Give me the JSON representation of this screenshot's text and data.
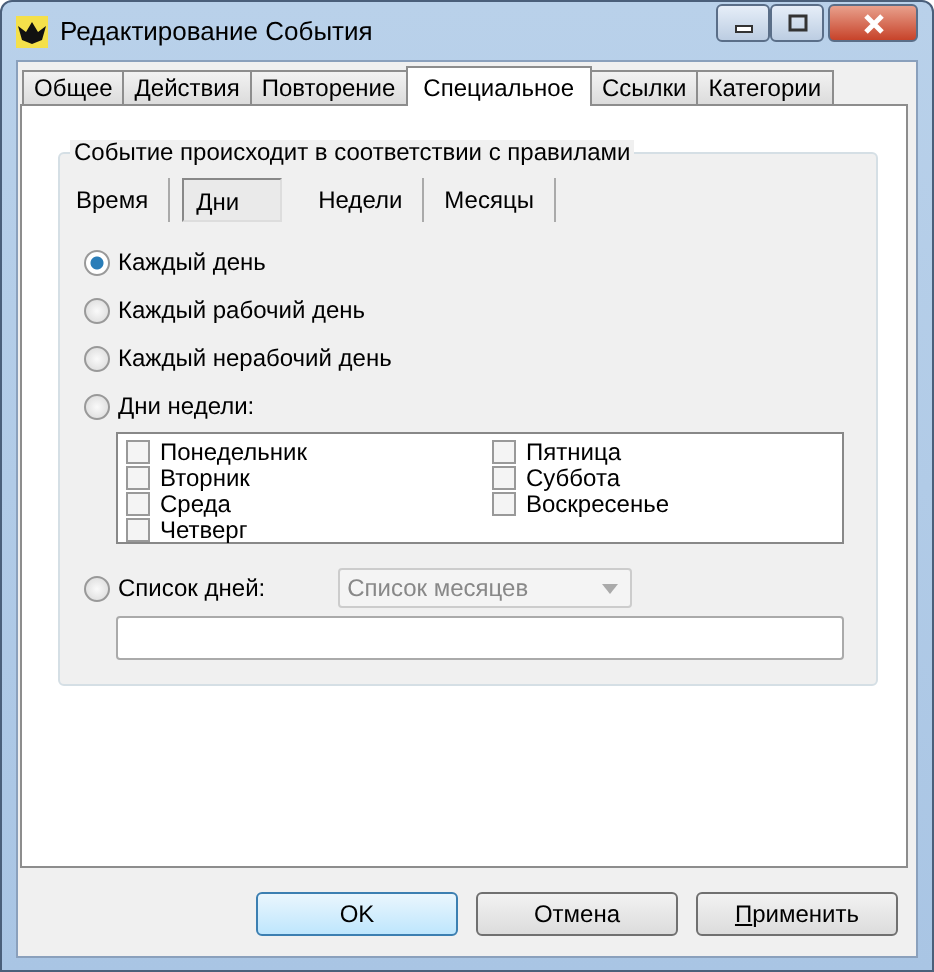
{
  "window": {
    "title": "Редактирование События"
  },
  "tabs": [
    {
      "label": "Общее",
      "selected": false
    },
    {
      "label": "Действия",
      "selected": false
    },
    {
      "label": "Повторение",
      "selected": false
    },
    {
      "label": "Специальное",
      "selected": true
    },
    {
      "label": "Ссылки",
      "selected": false
    },
    {
      "label": "Категории",
      "selected": false
    }
  ],
  "group": {
    "title": "Событие происходит в соответствии с правилами",
    "tabs": [
      {
        "label": "Время",
        "selected": false
      },
      {
        "label": "Дни",
        "selected": true
      },
      {
        "label": "Недели",
        "selected": false
      },
      {
        "label": "Месяцы",
        "selected": false
      }
    ],
    "options": [
      {
        "label": "Каждый день",
        "selected": true
      },
      {
        "label": "Каждый рабочий день",
        "selected": false
      },
      {
        "label": "Каждый нерабочий день",
        "selected": false
      },
      {
        "label": "Дни недели:",
        "selected": false
      }
    ],
    "weekdays": [
      {
        "label": "Понедельник",
        "checked": false
      },
      {
        "label": "Вторник",
        "checked": false
      },
      {
        "label": "Среда",
        "checked": false
      },
      {
        "label": "Четверг",
        "checked": false
      },
      {
        "label": "Пятница",
        "checked": false
      },
      {
        "label": "Суббота",
        "checked": false
      },
      {
        "label": "Воскресенье",
        "checked": false
      }
    ],
    "day_list": {
      "label": "Список дней:",
      "selected": false,
      "combo": "Список месяцев"
    }
  },
  "buttons": [
    {
      "label": "OK",
      "default": true
    },
    {
      "label": "Отмена",
      "default": false
    },
    {
      "label": "Применить",
      "default": false
    }
  ]
}
